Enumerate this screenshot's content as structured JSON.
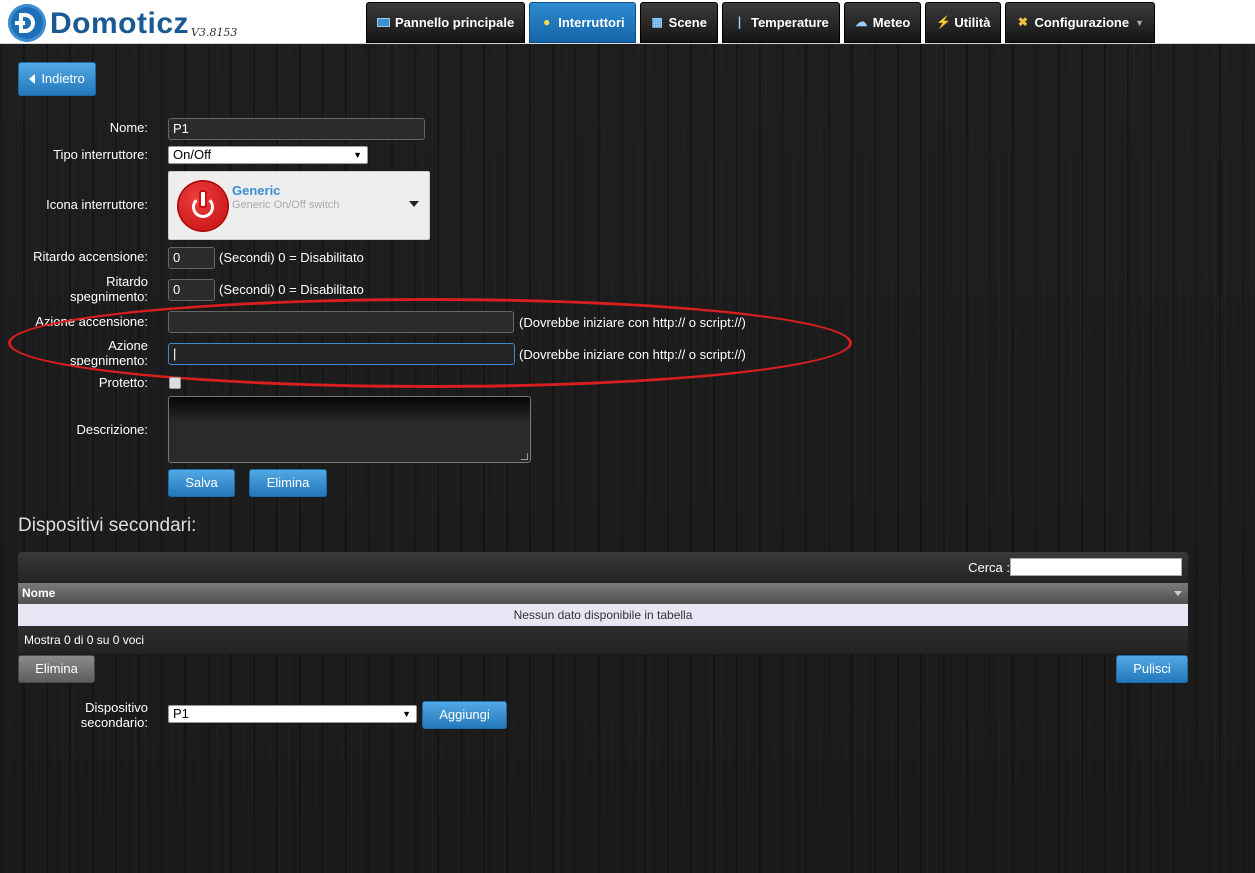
{
  "app": {
    "name": "Domoticz",
    "version": "V3.8153"
  },
  "nav": [
    {
      "label": "Pannello principale",
      "icon": "monitor-icon",
      "active": false
    },
    {
      "label": "Interruttori",
      "icon": "lightbulb-icon",
      "active": true
    },
    {
      "label": "Scene",
      "icon": "clapperboard-icon",
      "active": false
    },
    {
      "label": "Temperature",
      "icon": "thermometer-icon",
      "active": false
    },
    {
      "label": "Meteo",
      "icon": "weather-cloud-icon",
      "active": false
    },
    {
      "label": "Utilità",
      "icon": "utility-icon",
      "active": false
    },
    {
      "label": "Configurazione",
      "icon": "tools-icon",
      "active": false
    }
  ],
  "back_button": {
    "label": "Indietro"
  },
  "form": {
    "name_label": "Nome:",
    "name_value": "P1",
    "switch_type_label": "Tipo interruttore:",
    "switch_type_value": "On/Off",
    "switch_icon_label": "Icona interruttore:",
    "icon_name": "Generic",
    "icon_description": "Generic On/Off switch",
    "on_delay_label": "Ritardo accensione:",
    "on_delay_value": "0",
    "on_delay_hint": "(Secondi) 0 = Disabilitato",
    "off_delay_label_1": "Ritardo",
    "off_delay_label_2": "spegnimento:",
    "off_delay_value": "0",
    "off_delay_hint": "(Secondi) 0 = Disabilitato",
    "on_action_label": "Azione accensione:",
    "on_action_value": "",
    "on_action_hint": "(Dovrebbe iniziare con http:// o script://)",
    "off_action_label_1": "Azione",
    "off_action_label_2": "spegnimento:",
    "off_action_value": "|",
    "off_action_hint": "(Dovrebbe iniziare con http:// o script://)",
    "protected_label": "Protetto:",
    "protected_checked": false,
    "description_label": "Descrizione:",
    "description_value": "",
    "save_label": "Salva",
    "delete_label": "Elimina"
  },
  "subdevices": {
    "title": "Dispositivi secondari:",
    "search_label": "Cerca :",
    "search_value": "",
    "column_name": "Nome",
    "empty_text": "Nessun dato disponibile in tabella",
    "footer_text": "Mostra 0 di 0 su 0 voci",
    "delete_label": "Elimina",
    "clear_label": "Pulisci",
    "device_label_1": "Dispositivo",
    "device_label_2": "secondario:",
    "device_value": "P1",
    "add_label": "Aggiungi"
  },
  "colors": {
    "accent": "#2a85c9",
    "annotation": "#d81e1e",
    "active_tab": "#1f78be"
  }
}
